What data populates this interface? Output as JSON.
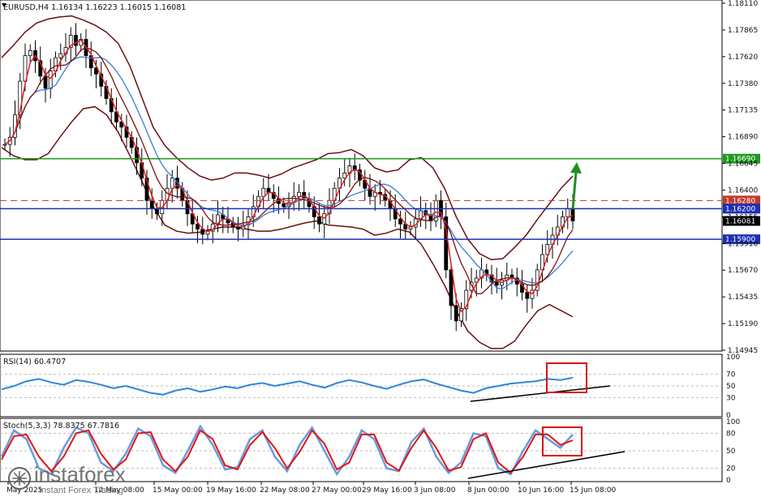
{
  "chart_data": {
    "type": "line",
    "symbol": "EURUSD",
    "timeframe": "H4",
    "header": "EURUSD,H4  1.16134 1.16223 1.16015 1.16081",
    "ohlc": {
      "open": 1.16134,
      "high": 1.16223,
      "low": 1.16015,
      "close": 1.16081
    },
    "price_axis": {
      "ticks": [
        "1.18110",
        "1.17865",
        "1.17620",
        "1.17380",
        "1.17135",
        "1.16890",
        "1.16645",
        "1.16400",
        "1.16155",
        "1.15910",
        "1.15670",
        "1.15435",
        "1.15190",
        "1.14945"
      ],
      "ylim": [
        1.1482,
        1.1823
      ]
    },
    "time_axis": {
      "labels": [
        "May 2025",
        "12 May 08:00",
        "15 May 00:00",
        "19 May 16:00",
        "22 May 08:00",
        "27 May 00:00",
        "29 May 16:00",
        "3 Jun 08:00",
        "8 Jun 00:00",
        "10 Jun 16:00",
        "15 Jun 08:00"
      ]
    },
    "levels": [
      {
        "price": 1.1669,
        "label": "1.16690",
        "color": "#1f9a1f",
        "style": "solid"
      },
      {
        "price": 1.1628,
        "label": "1.16280",
        "color": "#c0392b",
        "style": "dashed"
      },
      {
        "price": 1.162,
        "label": "1.16200",
        "color": "#1d2fb8",
        "style": "solid"
      },
      {
        "price": 1.1608,
        "label": "1.16081",
        "color": "#000000",
        "style": "current"
      },
      {
        "price": 1.159,
        "label": "1.15900",
        "color": "#1d2fb8",
        "style": "solid"
      }
    ],
    "close_series": [
      1.1683,
      1.169,
      1.1712,
      1.1745,
      1.177,
      1.1775,
      1.1765,
      1.175,
      1.1738,
      1.1755,
      1.1768,
      1.1772,
      1.1778,
      1.179,
      1.178,
      1.1786,
      1.177,
      1.1758,
      1.1752,
      1.174,
      1.1728,
      1.1715,
      1.1705,
      1.17,
      1.169,
      1.168,
      1.1665,
      1.165,
      1.1628,
      1.162,
      1.1615,
      1.1628,
      1.164,
      1.165,
      1.164,
      1.1628,
      1.1615,
      1.1605,
      1.16,
      1.1595,
      1.1598,
      1.1605,
      1.1614,
      1.161,
      1.1606,
      1.1602,
      1.16,
      1.1604,
      1.1612,
      1.1622,
      1.1632,
      1.164,
      1.1636,
      1.163,
      1.1625,
      1.1622,
      1.1626,
      1.1632,
      1.1636,
      1.163,
      1.1622,
      1.1612,
      1.1605,
      1.1615,
      1.1628,
      1.164,
      1.165,
      1.1655,
      1.1662,
      1.1658,
      1.1648,
      1.164,
      1.1632,
      1.1636,
      1.1634,
      1.1628,
      1.162,
      1.161,
      1.1605,
      1.16,
      1.1602,
      1.161,
      1.1618,
      1.1614,
      1.1608,
      1.1628,
      1.1612,
      1.156,
      1.1525,
      1.151,
      1.1522,
      1.154,
      1.1548,
      1.1552,
      1.156,
      1.1555,
      1.1548,
      1.1545,
      1.155,
      1.1555,
      1.1552,
      1.1546,
      1.1538,
      1.1532,
      1.154,
      1.156,
      1.1575,
      1.1585,
      1.1594,
      1.1602,
      1.1612,
      1.162,
      1.1608
    ],
    "bollinger_upper": [
      1.1768,
      1.178,
      1.1793,
      1.1802,
      1.1806,
      1.1808,
      1.1809,
      1.1805,
      1.18,
      1.1793,
      1.1782,
      1.176,
      1.173,
      1.17,
      1.1682,
      1.167,
      1.166,
      1.1652,
      1.1648,
      1.165,
      1.1655,
      1.1655,
      1.1653,
      1.165,
      1.1654,
      1.166,
      1.1664,
      1.1668,
      1.1674,
      1.1675,
      1.1678,
      1.1672,
      1.166,
      1.1656,
      1.1658,
      1.1668,
      1.167,
      1.166,
      1.164,
      1.1612,
      1.159,
      1.1576,
      1.157,
      1.1571,
      1.1582,
      1.1594,
      1.161,
      1.1625,
      1.164,
      1.1652
    ],
    "bollinger_lower": [
      1.168,
      1.1672,
      1.1668,
      1.1668,
      1.1674,
      1.169,
      1.1705,
      1.1718,
      1.172,
      1.1712,
      1.1695,
      1.1672,
      1.1648,
      1.1622,
      1.1604,
      1.1598,
      1.1596,
      1.1597,
      1.16,
      1.1602,
      1.1602,
      1.16,
      1.1598,
      1.1598,
      1.16,
      1.1603,
      1.1606,
      1.1608,
      1.1604,
      1.1603,
      1.1602,
      1.16,
      1.1594,
      1.1596,
      1.16,
      1.1597,
      1.1585,
      1.1566,
      1.1545,
      1.152,
      1.15,
      1.1489,
      1.1483,
      1.1483,
      1.149,
      1.1506,
      1.152,
      1.1526,
      1.152,
      1.1514
    ],
    "rsi": {
      "label": "RSI(14) 60.4707",
      "value": 60.4707,
      "levels": [
        30,
        50,
        70
      ],
      "scale_ticks": [
        "100",
        "70",
        "50",
        "30",
        "0"
      ],
      "series": [
        44,
        50,
        58,
        62,
        56,
        52,
        60,
        57,
        52,
        46,
        50,
        44,
        38,
        35,
        42,
        46,
        40,
        44,
        49,
        46,
        52,
        55,
        50,
        54,
        58,
        52,
        47,
        55,
        60,
        56,
        50,
        45,
        52,
        58,
        61,
        54,
        48,
        42,
        38,
        46,
        50,
        54,
        56,
        58,
        62,
        60,
        64
      ]
    },
    "stoch": {
      "label": "Stoch(5,3,3) 78.8375 67.7816",
      "k_value": 78.8375,
      "d_value": 67.7816,
      "levels": [
        20,
        50,
        80
      ],
      "scale_ticks": [
        "100",
        "80",
        "50",
        "20",
        "0"
      ],
      "k_series": [
        40,
        85,
        70,
        20,
        10,
        55,
        90,
        80,
        30,
        15,
        45,
        88,
        75,
        25,
        12,
        50,
        92,
        60,
        18,
        22,
        70,
        85,
        40,
        15,
        60,
        90,
        50,
        10,
        40,
        85,
        70,
        20,
        15,
        65,
        88,
        40,
        12,
        30,
        80,
        75,
        20,
        10,
        50,
        85,
        70,
        55,
        78
      ],
      "d_series": [
        35,
        75,
        78,
        40,
        15,
        40,
        80,
        85,
        45,
        18,
        35,
        80,
        82,
        35,
        15,
        40,
        85,
        70,
        25,
        18,
        60,
        82,
        55,
        20,
        48,
        85,
        62,
        18,
        30,
        78,
        78,
        30,
        16,
        55,
        85,
        55,
        16,
        22,
        70,
        80,
        30,
        12,
        40,
        78,
        78,
        60,
        68
      ]
    },
    "watermark": {
      "brand": "instaforex",
      "tagline": "Instant Forex Trading"
    }
  }
}
